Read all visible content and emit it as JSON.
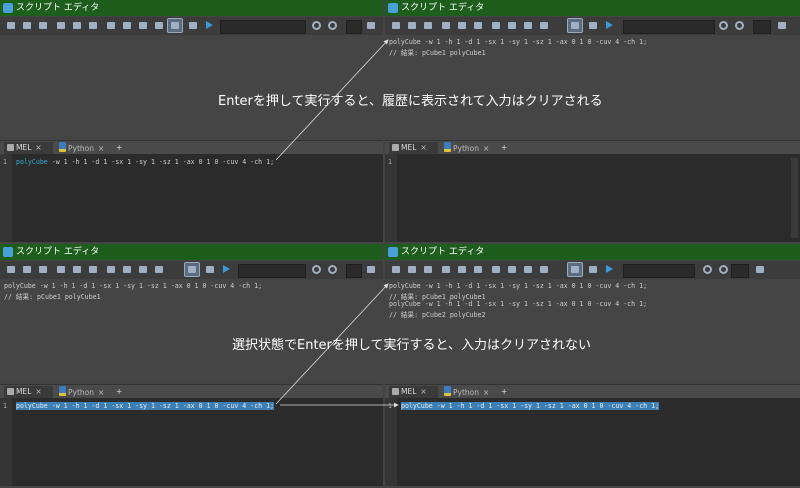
{
  "window_title": "スクリプト エディタ",
  "tabs": {
    "mel": "MEL",
    "python": "Python",
    "close": "×",
    "add": "+"
  },
  "cmd_prefix": "polyCube",
  "cmd_rest": " -w 1 -h 1 -d 1 -sx 1 -sy 1 -sz 1 -ax 0 1 0 -cuv 4 -ch 1;",
  "full_cmd": "polyCube -w 1 -h 1 -d 1 -sx 1 -sy 1 -sz 1 -ax 0 1 0 -cuv 4 -ch 1;",
  "result1": "// 結果: pCube1 polyCube1",
  "result2": "// 結果: pCube2 polyCube2",
  "line_number": "1",
  "annotation_top": "Enterを押して実行すると、履歴に表示されて入力はクリアされる",
  "annotation_bottom": "選択状態でEnterを押して実行すると、入力はクリアされない",
  "icons": [
    "open-icon",
    "import-icon",
    "save-icon",
    "clear-history-icon",
    "clear-input-icon",
    "clear-all-icon",
    "echo-commands-icon",
    "line-numbers-icon",
    "show-stack-trace-icon",
    "execute-icon",
    "execute-all-icon",
    "find-icon",
    "replace-icon",
    "goto-line-icon"
  ]
}
